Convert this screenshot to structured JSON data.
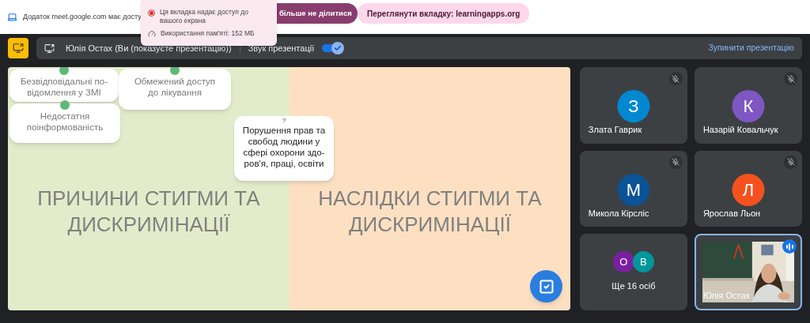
{
  "browser_banner": {
    "message": "Додаток meet.google.com має досту",
    "stop_button": "більше не ділитися",
    "switch_button": "Переглянути вкладку: learningapps.org"
  },
  "tab_popup": {
    "items": [
      {
        "kind": "sharing",
        "text": "Ця вкладка надає доступ до вашого екрана"
      },
      {
        "kind": "memory",
        "text": "Використання пам'яті: 152 МБ"
      }
    ]
  },
  "presentation_bar": {
    "presenter": "Юлія Остах (Ви (показуєте презентацію))",
    "audio_label": "Звук презентації",
    "audio_on": true,
    "stop_button": "Зупинити презентацію"
  },
  "slide": {
    "titles": [
      "ПРИЧИНИ СТИГМИ ТА ДИСКРИМІНАЦІЇ",
      "НАСЛІДКИ СТИГМИ ТА ДИСКРИМІНАЦІЇ"
    ],
    "cards": [
      {
        "kind": "dot",
        "lines": [
          "Безвідповідальні по-",
          "відомлення у ЗМІ"
        ]
      },
      {
        "kind": "dot",
        "lines": [
          "Обмежений доступ",
          "до лікування"
        ]
      },
      {
        "kind": "dot",
        "lines": [
          "Недостатня",
          "поінформованість"
        ]
      },
      {
        "kind": "question",
        "question": "?",
        "lines": [
          "Порушення прав та",
          "свобод людини у",
          "сфері охорони здо-",
          "ров'я, праці, освіти"
        ]
      }
    ]
  },
  "participants": [
    {
      "kind": "avatar",
      "initial": "З",
      "name": "Злата Гаврик",
      "color": "#0288d1",
      "muted": true
    },
    {
      "kind": "avatar",
      "initial": "К",
      "name": "Назарій Ковальчук",
      "color": "#7e57c2",
      "muted": true
    },
    {
      "kind": "avatar",
      "initial": "М",
      "name": "Микола Кірсліс",
      "color": "#0b5394",
      "muted": true
    },
    {
      "kind": "avatar",
      "initial": "Л",
      "name": "Ярослав Льон",
      "color": "#f4511e",
      "muted": true
    },
    {
      "kind": "group",
      "avatars": [
        {
          "initial": "О",
          "color": "#7b1fa2"
        },
        {
          "initial": "В",
          "color": "#00979d"
        }
      ],
      "label": "Ще 16 осіб"
    },
    {
      "kind": "video",
      "name": "Юлія Остах",
      "speaking": true
    }
  ]
}
